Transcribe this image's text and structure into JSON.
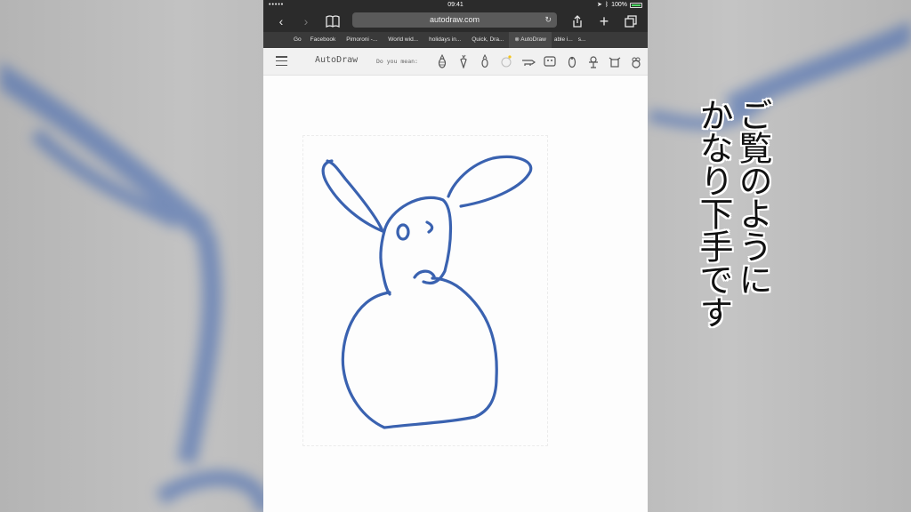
{
  "status_bar": {
    "signal": "•••••",
    "time": "09:41",
    "battery": "100%",
    "battery_color": "#4cd964"
  },
  "browser": {
    "url": "autodraw.com",
    "tabs": [
      {
        "label": "Go"
      },
      {
        "label": "Facebook"
      },
      {
        "label": "Pimoroni -..."
      },
      {
        "label": "World wid..."
      },
      {
        "label": "holidays in..."
      },
      {
        "label": "Quick, Dra..."
      },
      {
        "label": "AutoDraw",
        "active": true
      },
      {
        "label": "able i..."
      },
      {
        "label": "s..."
      }
    ]
  },
  "app": {
    "name": "AutoDraw",
    "suggestion_prompt": "Do you mean:",
    "suggestions": [
      "pineapple-icon",
      "carrot-icon",
      "pineapple-icon",
      "face-icon",
      "rhino-icon",
      "mask-icon",
      "penguin-icon",
      "bear-icon",
      "robot-icon",
      "owl-icon"
    ],
    "stroke_color": "#3a62b0"
  },
  "caption": {
    "line1": "ご覧のようにか",
    "line2": "なり下手です",
    "col_left": "かなり下手です",
    "col_right": "ご覧のように"
  }
}
